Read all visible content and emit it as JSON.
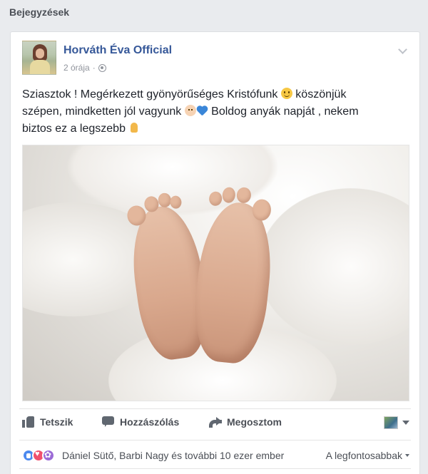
{
  "section": {
    "title": "Bejegyzések"
  },
  "post": {
    "author": "Horváth Éva Official",
    "time": "2 órája",
    "text_line1_a": "Sziasztok ! Megérkezett gyönyörűséges Kristófunk",
    "text_line1_b": "köszönjük",
    "text_line2_a": "szépen, mindketten jól vagyunk",
    "text_line2_b": "Boldog anyák napját , nekem",
    "text_line3": "biztos ez a legszebb",
    "emoji_icons": [
      "smile-icon",
      "baby-icon",
      "blue-heart-icon",
      "pray-icon"
    ]
  },
  "actions": {
    "like_label": "Tetszik",
    "comment_label": "Hozzászólás",
    "share_label": "Megosztom"
  },
  "reactions": {
    "summary": "Dániel Sütő, Barbi Nagy és további 10 ezer ember",
    "sort_label": "A legfontosabbak",
    "icons": [
      "like",
      "love",
      "flower"
    ]
  },
  "colors": {
    "link": "#365899",
    "page_bg": "#e9ebee",
    "text": "#1d2129",
    "secondary_text": "#90949c"
  }
}
